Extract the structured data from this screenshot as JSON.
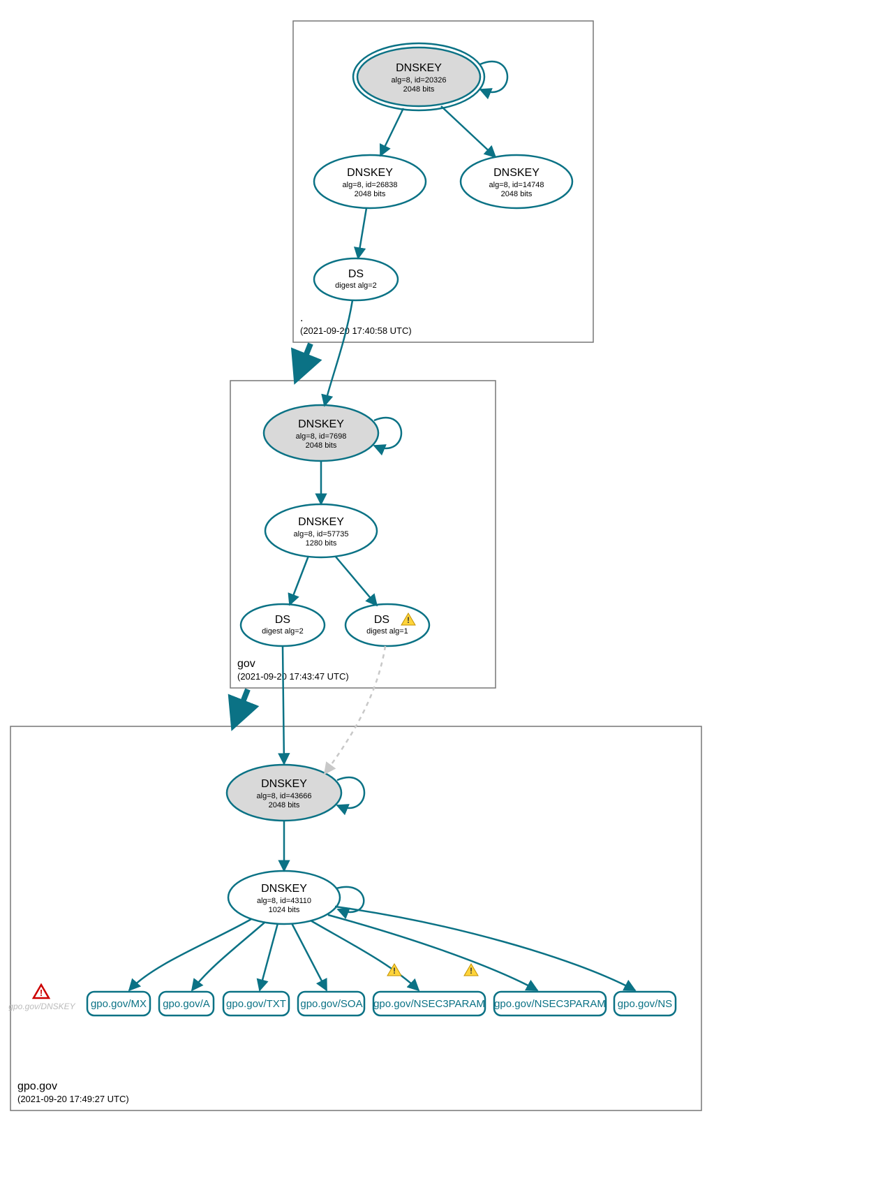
{
  "zones": {
    "root": {
      "name": ".",
      "timestamp": "(2021-09-20 17:40:58 UTC)"
    },
    "gov": {
      "name": "gov",
      "timestamp": "(2021-09-20 17:43:47 UTC)"
    },
    "gpo": {
      "name": "gpo.gov",
      "timestamp": "(2021-09-20 17:49:27 UTC)"
    }
  },
  "nodes": {
    "root_ksk": {
      "title": "DNSKEY",
      "sub1": "alg=8, id=20326",
      "sub2": "2048 bits"
    },
    "root_zsk1": {
      "title": "DNSKEY",
      "sub1": "alg=8, id=26838",
      "sub2": "2048 bits"
    },
    "root_zsk2": {
      "title": "DNSKEY",
      "sub1": "alg=8, id=14748",
      "sub2": "2048 bits"
    },
    "root_ds": {
      "title": "DS",
      "sub1": "digest alg=2"
    },
    "gov_ksk": {
      "title": "DNSKEY",
      "sub1": "alg=8, id=7698",
      "sub2": "2048 bits"
    },
    "gov_zsk": {
      "title": "DNSKEY",
      "sub1": "alg=8, id=57735",
      "sub2": "1280 bits"
    },
    "gov_ds2": {
      "title": "DS",
      "sub1": "digest alg=2"
    },
    "gov_ds1": {
      "title": "DS",
      "sub1": "digest alg=1"
    },
    "gpo_ksk": {
      "title": "DNSKEY",
      "sub1": "alg=8, id=43666",
      "sub2": "2048 bits"
    },
    "gpo_zsk": {
      "title": "DNSKEY",
      "sub1": "alg=8, id=43110",
      "sub2": "1024 bits"
    }
  },
  "rr": {
    "mx": "gpo.gov/MX",
    "a": "gpo.gov/A",
    "txt": "gpo.gov/TXT",
    "soa": "gpo.gov/SOA",
    "nsec3a": "gpo.gov/NSEC3PARAM",
    "nsec3b": "gpo.gov/NSEC3PARAM",
    "ns": "gpo.gov/NS"
  },
  "phantom": "gpo.gov/DNSKEY",
  "colors": {
    "stroke": "#0b7285",
    "nodeFill": "#d9d9d9",
    "boxStroke": "#777",
    "dashed": "#c8c8c8"
  }
}
